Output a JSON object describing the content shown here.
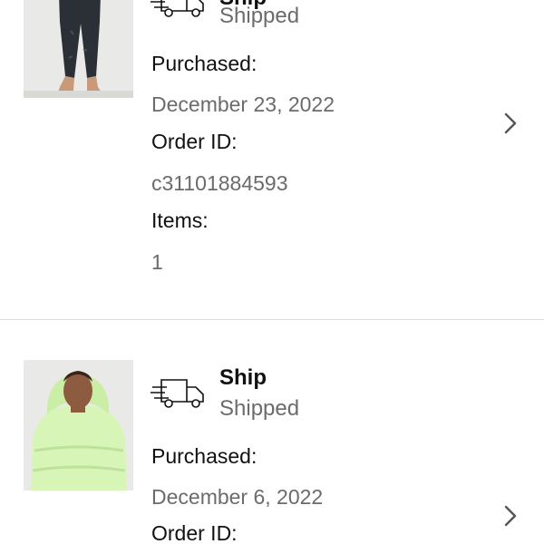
{
  "orders": [
    {
      "title": "Ship",
      "status": "Shipped",
      "purchased_label": "Purchased:",
      "purchased_date": "December 23, 2022",
      "order_id_label": "Order ID:",
      "order_id": "c31101884593",
      "items_label": "Items:",
      "items_count": "1",
      "thumb_icon": "jogger-pants-product-image",
      "colors": {
        "pants": "#2b2f36",
        "background": "#e9e9e7",
        "skin": "#c89a7a"
      }
    },
    {
      "title": "Ship",
      "status": "Shipped",
      "purchased_label": "Purchased:",
      "purchased_date": "December 6, 2022",
      "order_id_label": "Order ID:",
      "thumb_icon": "puffer-jacket-product-image",
      "colors": {
        "jacket": "#d8f5b8",
        "background": "#e9e9e7",
        "skin": "#8d5b3f"
      }
    }
  ],
  "icons": {
    "ship": "delivery-truck-icon",
    "chevron": "chevron-right-icon"
  }
}
